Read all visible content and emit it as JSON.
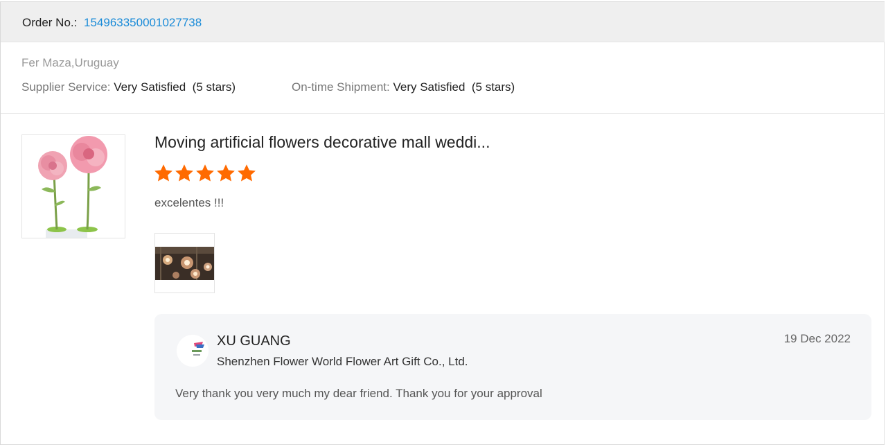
{
  "order": {
    "label": "Order No.:",
    "number": "154963350001027738"
  },
  "buyer": {
    "name": "Fer Maza,Uruguay"
  },
  "ratings": {
    "supplier_service_label": "Supplier Service:",
    "supplier_service_value": "Very Satisfied",
    "supplier_service_stars": "(5 stars)",
    "shipment_label": "On-time Shipment:",
    "shipment_value": "Very Satisfied",
    "shipment_stars": "(5 stars)"
  },
  "product": {
    "title": "Moving artificial flowers decorative mall weddi...",
    "image_icon": "pink-peony-flowers-image",
    "rating": 5,
    "star_color": "#ff6a00",
    "review": "excelentes !!!",
    "review_photo_icon": "glowing-flower-lamps-photo"
  },
  "reply": {
    "avatar_icon": "supplier-logo-icon",
    "name": "XU GUANG",
    "company": "Shenzhen Flower World Flower Art Gift Co., Ltd.",
    "date": "19 Dec 2022",
    "text": "Very thank you very much my dear friend. Thank you for your approval"
  },
  "colors": {
    "link": "#1a8bd8",
    "header_bg": "#efefef",
    "reply_bg": "#f5f6f8"
  }
}
